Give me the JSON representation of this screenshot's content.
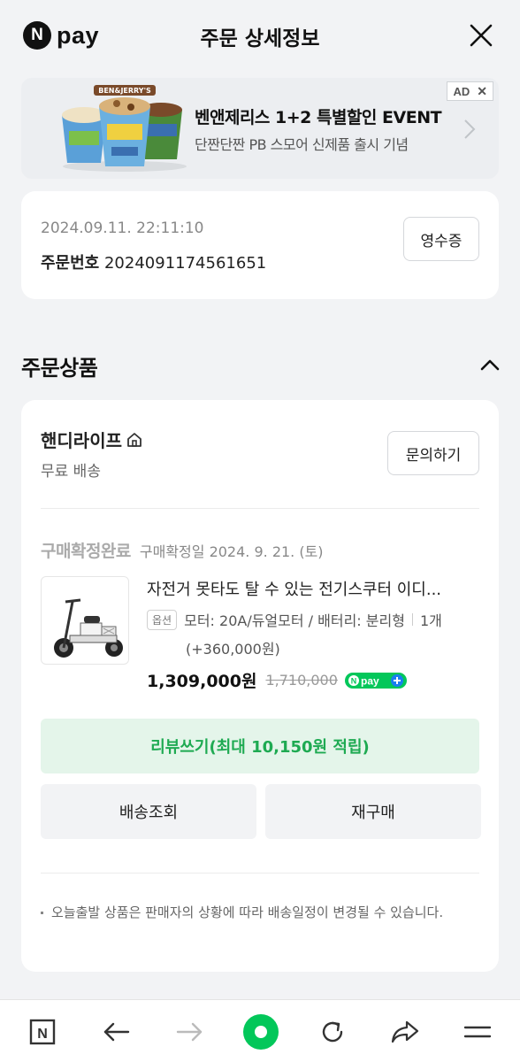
{
  "header": {
    "logo_letter": "N",
    "logo_text": "pay",
    "title": "주문 상세정보"
  },
  "ad": {
    "title": "벤앤제리스 1+2 특별할인 EVENT",
    "subtitle": "단짠단짠 PB 스모어 신제품 출시 기념",
    "badge": "AD",
    "badge_close": "✕"
  },
  "order": {
    "datetime": "2024.09.11. 22:11:10",
    "number_label": "주문번호",
    "number": "2024091174561651",
    "receipt_label": "영수증"
  },
  "section": {
    "title": "주문상품"
  },
  "seller": {
    "name": "핸디라이프",
    "shipping": "무료 배송",
    "inquiry_label": "문의하기"
  },
  "item": {
    "status": "구매확정완료",
    "status_date": "구매확정일 2024. 9. 21. (토)",
    "name": "자전거 못타도 탈 수 있는 전기스쿠터 이디...",
    "option_badge": "옵션",
    "option_text": "모터: 20A/듀얼모터 / 배터리: 분리형",
    "quantity": "1개",
    "option_extra": "(+360,000원)",
    "price": "1,309,000원",
    "original_price": "1,710,000"
  },
  "actions": {
    "review": "리뷰쓰기(최대 10,150원 적립)",
    "track": "배송조회",
    "rebuy": "재구매"
  },
  "notice": "오늘출발 상품은 판매자의 상황에 따라 배송일정이 변경될 수 있습니다.",
  "bottom_nav": {
    "home_letter": "N"
  },
  "colors": {
    "naver_green": "#03c75a",
    "review_bg": "#e4f5ea",
    "review_text": "#1eaa52",
    "page_bg": "#f2f3f5"
  }
}
